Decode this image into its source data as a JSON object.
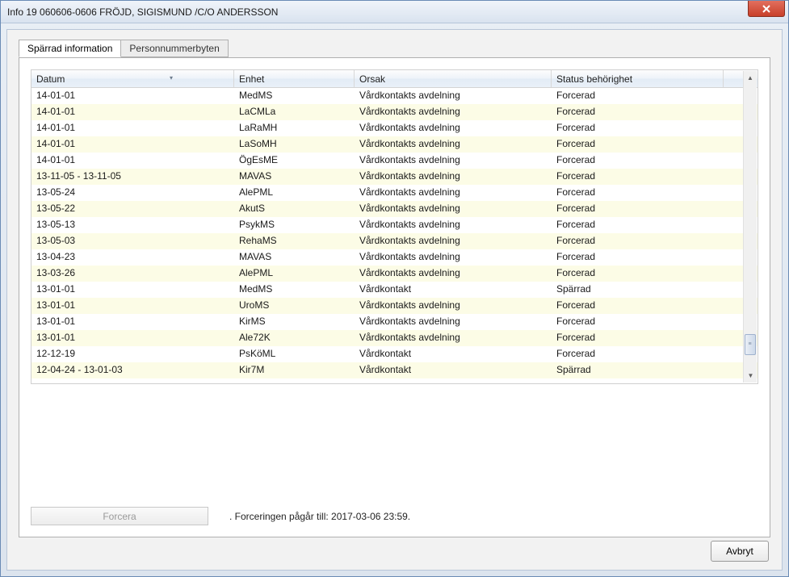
{
  "window": {
    "title": "Info 19 060606-0606 FRÖJD, SIGISMUND /C/O ANDERSSON"
  },
  "tabs": {
    "active": "Spärrad information",
    "items": [
      {
        "label": "Spärrad information"
      },
      {
        "label": "Personnummerbyten"
      }
    ]
  },
  "grid": {
    "columns": {
      "datum": "Datum",
      "enhet": "Enhet",
      "orsak": "Orsak",
      "status": "Status behörighet"
    },
    "rows": [
      {
        "datum": "14-01-01",
        "enhet": "MedMS",
        "orsak": "Vårdkontakts avdelning",
        "status": "Forcerad"
      },
      {
        "datum": "14-01-01",
        "enhet": "LaCMLa",
        "orsak": "Vårdkontakts avdelning",
        "status": "Forcerad"
      },
      {
        "datum": "14-01-01",
        "enhet": "LaRaMH",
        "orsak": "Vårdkontakts avdelning",
        "status": "Forcerad"
      },
      {
        "datum": "14-01-01",
        "enhet": "LaSoMH",
        "orsak": "Vårdkontakts avdelning",
        "status": "Forcerad"
      },
      {
        "datum": "14-01-01",
        "enhet": "ÖgEsME",
        "orsak": "Vårdkontakts avdelning",
        "status": "Forcerad"
      },
      {
        "datum": "13-11-05 - 13-11-05",
        "enhet": "MAVAS",
        "orsak": "Vårdkontakts avdelning",
        "status": "Forcerad"
      },
      {
        "datum": "13-05-24",
        "enhet": "AlePML",
        "orsak": "Vårdkontakts avdelning",
        "status": "Forcerad"
      },
      {
        "datum": "13-05-22",
        "enhet": "AkutS",
        "orsak": "Vårdkontakts avdelning",
        "status": "Forcerad"
      },
      {
        "datum": "13-05-13",
        "enhet": "PsykMS",
        "orsak": "Vårdkontakts avdelning",
        "status": "Forcerad"
      },
      {
        "datum": "13-05-03",
        "enhet": "RehaMS",
        "orsak": "Vårdkontakts avdelning",
        "status": "Forcerad"
      },
      {
        "datum": "13-04-23",
        "enhet": "MAVAS",
        "orsak": "Vårdkontakts avdelning",
        "status": "Forcerad"
      },
      {
        "datum": "13-03-26",
        "enhet": "AlePML",
        "orsak": "Vårdkontakts avdelning",
        "status": "Forcerad"
      },
      {
        "datum": "13-01-01",
        "enhet": "MedMS",
        "orsak": "Vårdkontakt",
        "status": "Spärrad"
      },
      {
        "datum": "13-01-01",
        "enhet": "UroMS",
        "orsak": "Vårdkontakts avdelning",
        "status": "Forcerad"
      },
      {
        "datum": "13-01-01",
        "enhet": "KirMS",
        "orsak": "Vårdkontakts avdelning",
        "status": "Forcerad"
      },
      {
        "datum": "13-01-01",
        "enhet": "Ale72K",
        "orsak": "Vårdkontakts avdelning",
        "status": "Forcerad"
      },
      {
        "datum": "12-12-19",
        "enhet": "PsKöML",
        "orsak": "Vårdkontakt",
        "status": "Forcerad"
      },
      {
        "datum": "12-04-24 - 13-01-03",
        "enhet": "Kir7M",
        "orsak": "Vårdkontakt",
        "status": "Spärrad"
      }
    ]
  },
  "footer": {
    "forcera_label": "Forcera",
    "status_text": ". Forceringen pågår till: 2017-03-06 23:59.",
    "avbryt_label": "Avbryt"
  }
}
